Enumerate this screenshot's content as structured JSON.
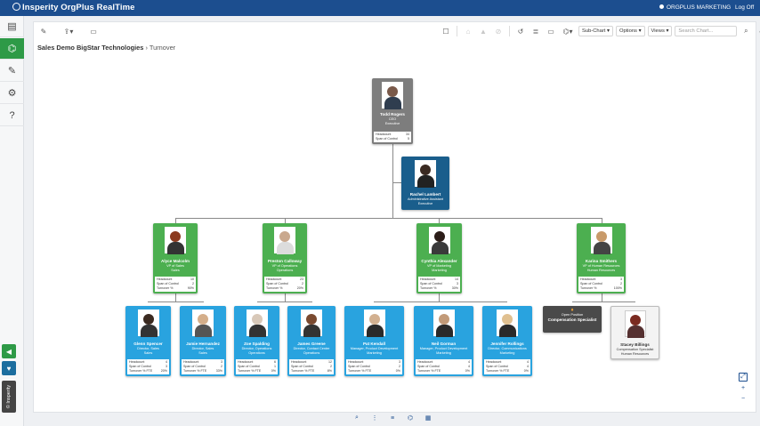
{
  "app": {
    "title": "Insperity OrgPlus RealTime",
    "user": "ORGPLUS MARKETING",
    "logoff": "Log Off"
  },
  "sidebar": {
    "items": [
      {
        "name": "directory-icon",
        "glyph": "▤"
      },
      {
        "name": "org-chart-icon",
        "glyph": "⌬",
        "active": true
      },
      {
        "name": "edit-icon",
        "glyph": "✎"
      },
      {
        "name": "settings-icon",
        "glyph": "⚙"
      },
      {
        "name": "help-icon",
        "glyph": "?"
      }
    ],
    "bottom": [
      {
        "name": "announce-icon",
        "glyph": "◀",
        "color": "#2e9a47"
      },
      {
        "name": "feedback-icon",
        "glyph": "♥",
        "color": "#1c6e9f"
      }
    ],
    "vertical_label": "© Insperity"
  },
  "toolbar": {
    "left_icons": [
      {
        "name": "pencil-icon",
        "glyph": "✎"
      },
      {
        "name": "export-icon",
        "glyph": "⇪▾"
      },
      {
        "name": "print-icon",
        "glyph": "▭"
      }
    ],
    "right_icons": [
      {
        "name": "select-icon",
        "glyph": "☐",
        "dim": false
      },
      {
        "name": "home-icon",
        "glyph": "⌂",
        "dim": true
      },
      {
        "name": "up-icon",
        "glyph": "▲",
        "dim": true
      },
      {
        "name": "blocked-icon",
        "glyph": "⊘",
        "dim": true
      },
      {
        "name": "history-icon",
        "glyph": "↺",
        "dim": false
      },
      {
        "name": "list-icon",
        "glyph": "≣",
        "dim": false
      },
      {
        "name": "window-icon",
        "glyph": "▭",
        "dim": false
      },
      {
        "name": "layout-icon",
        "glyph": "⌬▾",
        "dim": false
      }
    ],
    "subchart": "Sub-Chart",
    "options": "Options",
    "views": "Views",
    "search_placeholder": "Search Chart...",
    "search_icon": "⌕",
    "account_icon": "●"
  },
  "breadcrumb": {
    "chart": "Sales Demo BigStar Technologies",
    "sep": "›",
    "view": "Turnover"
  },
  "stat_labels": {
    "headcount": "Headcount",
    "span": "Span of Control",
    "turnover": "Turnover %",
    "turnover_fte": "Turnover % FTE"
  },
  "people": {
    "ceo": {
      "name": "Todd Rogers",
      "title": "CEO",
      "dept": "Executive",
      "headcount": "34",
      "span": "5"
    },
    "assistant": {
      "name": "Rachel Lambert",
      "title": "Administrative Assistant",
      "dept": "Executive"
    },
    "vp1": {
      "name": "Alyce Malcolm",
      "title": "VP of Sales",
      "dept": "Sales",
      "headcount": "10",
      "span": "2",
      "turnover": "90%"
    },
    "vp2": {
      "name": "Preston Calloway",
      "title": "VP of Operations",
      "dept": "Operations",
      "headcount": "23",
      "span": "2",
      "turnover": "20%"
    },
    "vp3": {
      "name": "Cynthia Alexander",
      "title": "VP of Marketing",
      "dept": "Marketing",
      "headcount": "14",
      "span": "3",
      "turnover": "30%"
    },
    "vp4": {
      "name": "Karina Smithers",
      "title": "VP of Human Resources",
      "dept": "Human Resources",
      "headcount": "3",
      "span": "2",
      "turnover": "100%"
    },
    "m1": {
      "name": "Glenn Spencer",
      "title": "Director, Sales",
      "dept": "Sales",
      "headcount": "4",
      "span": "3",
      "turnover": "20%"
    },
    "m2": {
      "name": "Jamie Hernandez",
      "title": "Director, Sales",
      "dept": "Sales",
      "headcount": "3",
      "span": "2",
      "turnover": "33%"
    },
    "m3": {
      "name": "Zoe Spalding",
      "title": "Director, Operations",
      "dept": "Operations",
      "headcount": "6",
      "span": "1",
      "turnover": "0%"
    },
    "m4": {
      "name": "James Greene",
      "title": "Director, Contact Center",
      "dept": "Operations",
      "headcount": "12",
      "span": "2",
      "turnover": "8%"
    },
    "m5": {
      "name": "Pat Kendall",
      "title": "Manager, Product Development",
      "dept": "Marketing",
      "headcount": "3",
      "span": "2",
      "turnover": "0%"
    },
    "m6": {
      "name": "Neil Gorman",
      "title": "Manager, Product Development",
      "dept": "Marketing",
      "headcount": "4",
      "span": "4",
      "turnover": "0%"
    },
    "m7": {
      "name": "Jennifer Rollings",
      "title": "Director, Communications",
      "dept": "Marketing",
      "headcount": "4",
      "span": "4",
      "turnover": "0%"
    },
    "open": {
      "label": "Open Position",
      "title": "Compensation Specialist"
    },
    "m9": {
      "name": "Stacey Billings",
      "title": "Compensation Specialist",
      "dept": "Human Resources"
    }
  },
  "zoom": [
    {
      "name": "fit-icon",
      "glyph": "⤢"
    },
    {
      "name": "zoom-in-icon",
      "glyph": "+"
    },
    {
      "name": "zoom-out-icon",
      "glyph": "−"
    }
  ],
  "bottom_bar": [
    {
      "name": "find-icon",
      "glyph": "⌕"
    },
    {
      "name": "tree-icon",
      "glyph": "⋮"
    },
    {
      "name": "list-view-icon",
      "glyph": "≡"
    },
    {
      "name": "hierarchy-icon",
      "glyph": "⌬"
    },
    {
      "name": "grid-icon",
      "glyph": "▦"
    }
  ]
}
